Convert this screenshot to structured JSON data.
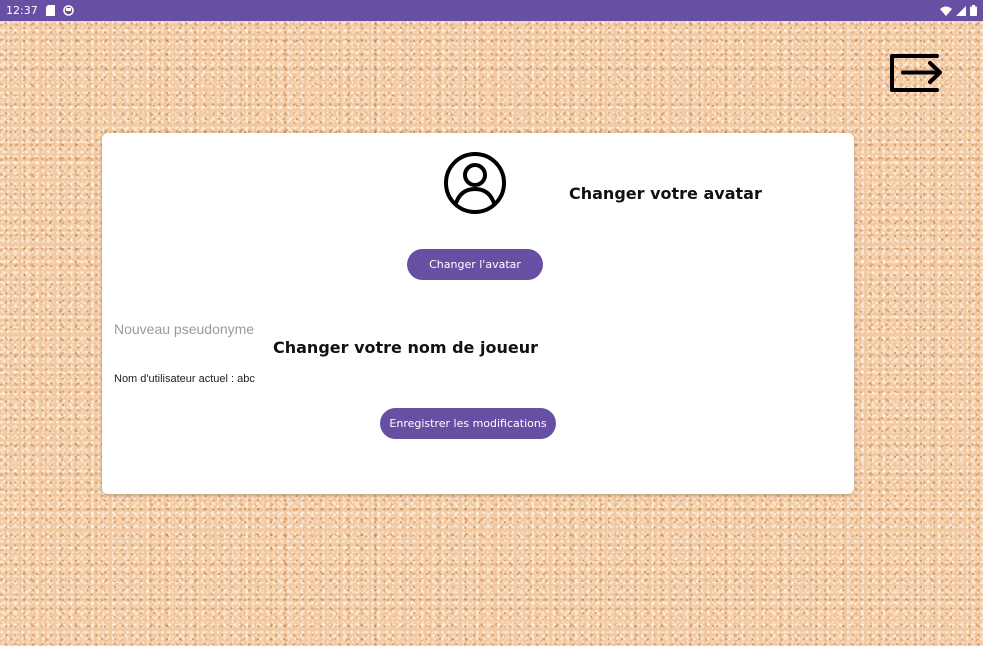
{
  "status_bar": {
    "time": "12:37",
    "left_icons": [
      "sd-card-icon",
      "sync-circle-icon"
    ],
    "right_icons": [
      "wifi-icon",
      "signal-icon",
      "battery-icon"
    ],
    "color": "#6750a4"
  },
  "toolbar": {
    "logout_icon": "logout-icon"
  },
  "profile": {
    "avatar_icon": "account-circle-icon",
    "avatar_title": "Changer votre avatar",
    "change_avatar_label": "Changer l'avatar",
    "pseudo_placeholder": "Nouveau pseudonyme",
    "pseudo_value": "",
    "name_title": "Changer votre nom de joueur",
    "current_user_text": "Nom d'utilisateur actuel : abc",
    "save_label": "Enregistrer les modifications"
  },
  "colors": {
    "accent": "#6750a4",
    "card": "#ffffff",
    "background": "#f2c9a0"
  }
}
